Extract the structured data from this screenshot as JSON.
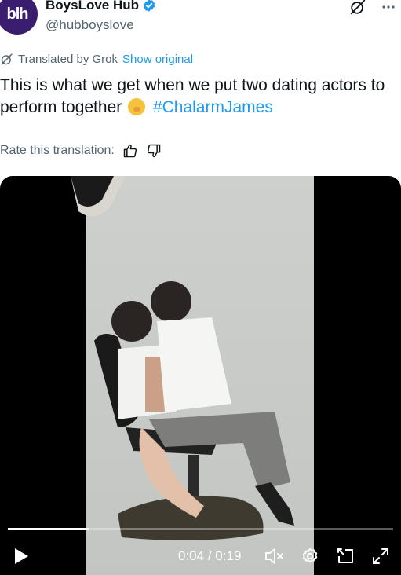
{
  "header": {
    "avatar_text": "blh",
    "display_name": "BoysLove Hub",
    "handle": "@hubboyslove",
    "icons": [
      "grok-icon",
      "more-icon"
    ]
  },
  "translation": {
    "label": "Translated by Grok",
    "show_original": "Show original"
  },
  "tweet": {
    "text_part1": "This is what we get when we put two dating actors to perform together",
    "hashtag": "#ChalarmJames"
  },
  "rate": {
    "label": "Rate this translation:"
  },
  "video": {
    "current_time": "0:04",
    "separator": "/",
    "duration": "0:19",
    "progress": 0.21
  },
  "colors": {
    "accent": "#1d9bf0",
    "text": "#0f1419",
    "muted": "#536471",
    "avatar_bg": "#3a1d6e"
  }
}
